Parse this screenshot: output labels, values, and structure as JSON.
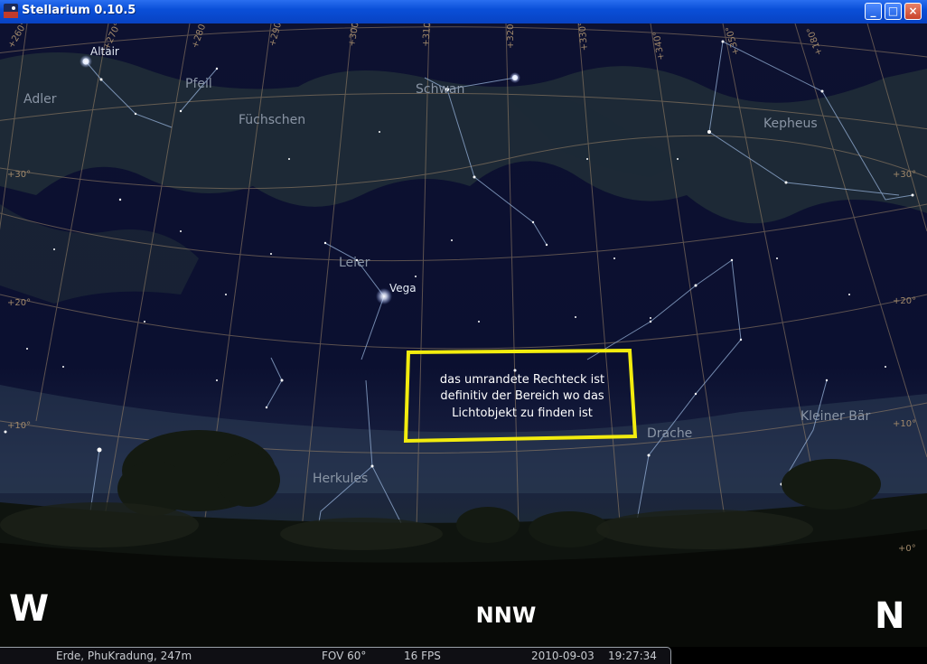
{
  "window": {
    "title": "Stellarium 0.10.5",
    "buttons": {
      "minimize": "_",
      "maximize": "□",
      "close": "×"
    }
  },
  "sky": {
    "constellations": [
      "Adler",
      "Pfeil",
      "Füchschen",
      "Schwan",
      "Kepheus",
      "Leier",
      "Herkules",
      "Drache",
      "Kleiner Bär"
    ],
    "stars": [
      "Altair",
      "Vega"
    ],
    "altitude_labels": {
      "left": [
        "+30°",
        "+20°",
        "+10°"
      ],
      "right": [
        "+30°",
        "+20°",
        "+10°",
        "+0°"
      ]
    },
    "azimuth_labels": [
      "+280°",
      "+290°",
      "+300°",
      "+310°",
      "+320°",
      "+330°",
      "+340°",
      "+350°",
      "+180°",
      "+260°",
      "+270°"
    ]
  },
  "annotation": {
    "text": [
      "das umrandete Rechteck ist",
      "definitiv der Bereich wo das",
      "Lichtobjekt zu finden ist"
    ],
    "color": "#f2ec0e"
  },
  "compass": {
    "west": "W",
    "center": "NNW",
    "north": "N"
  },
  "status": {
    "location": "Erde, PhuKradung, 247m",
    "fov": "FOV 60°",
    "fps": "16 FPS",
    "date": "2010-09-03",
    "time": "19:27:34"
  }
}
